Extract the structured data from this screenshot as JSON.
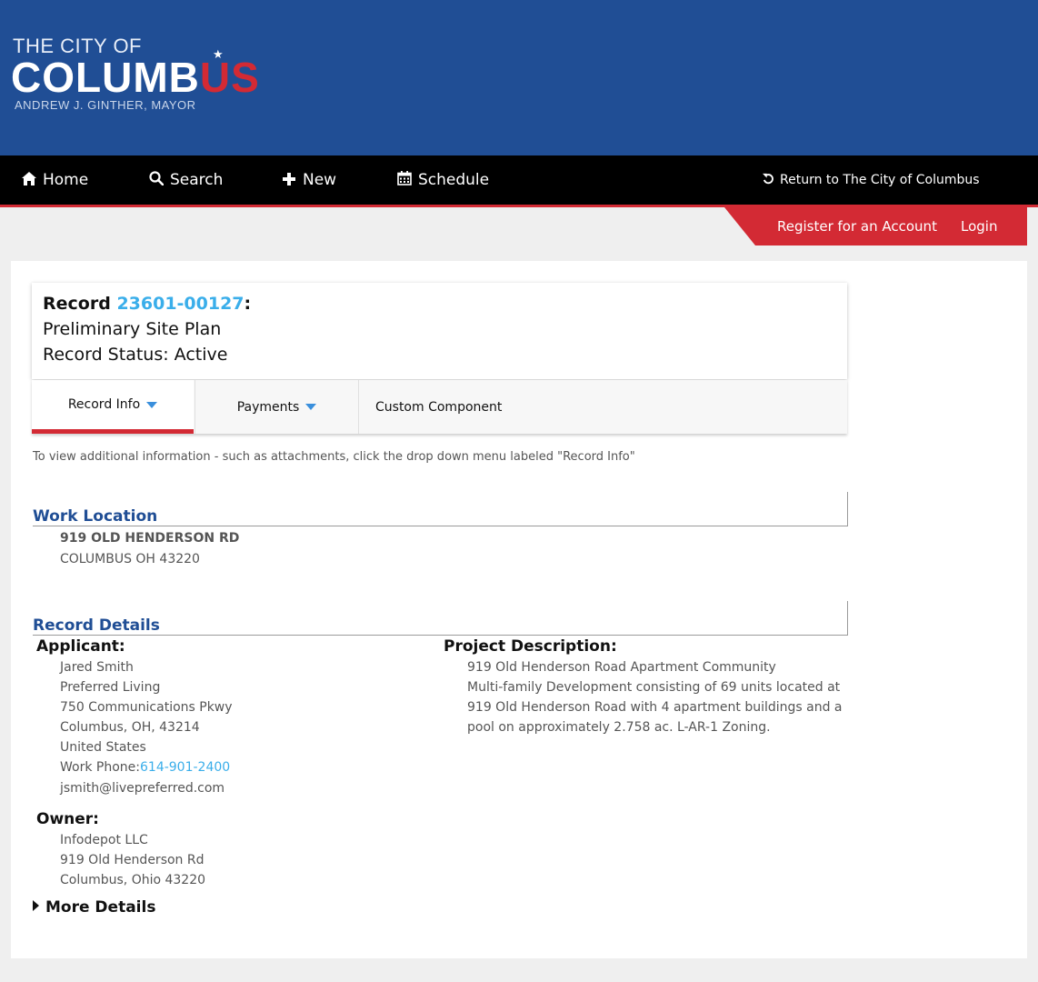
{
  "logo": {
    "line1": "THE CITY OF",
    "line2_main": "COLUMB",
    "line2_accent": "US",
    "line3": "ANDREW J. GINTHER, MAYOR"
  },
  "nav": {
    "items": [
      {
        "label": "Home",
        "icon": "home-icon"
      },
      {
        "label": "Search",
        "icon": "search-icon"
      },
      {
        "label": "New",
        "icon": "plus-icon"
      },
      {
        "label": "Schedule",
        "icon": "calendar-icon"
      }
    ],
    "return_label": "Return to The City of Columbus"
  },
  "account": {
    "register_label": "Register for an Account",
    "login_label": "Login"
  },
  "record": {
    "prefix": "Record",
    "number": "23601-00127",
    "suffix": ":",
    "type": "Preliminary Site Plan",
    "status": "Record Status: Active"
  },
  "tabs": [
    {
      "label": "Record Info"
    },
    {
      "label": "Payments"
    },
    {
      "label": "Custom Component"
    }
  ],
  "hint": "To view additional information - such as attachments, click the drop down menu labeled \"Record Info\"",
  "work_location": {
    "title": "Work Location",
    "address1": "919 OLD HENDERSON RD",
    "address2": "COLUMBUS OH 43220"
  },
  "record_details": {
    "title": "Record Details",
    "applicant": {
      "label": "Applicant:",
      "name": "Jared Smith",
      "company": "Preferred Living",
      "street": "750 Communications Pkwy",
      "city": "Columbus, OH, 43214",
      "country": "United States",
      "phone_label": "Work Phone:",
      "phone": "614-901-2400",
      "email": "jsmith@livepreferred.com"
    },
    "owner": {
      "label": "Owner:",
      "name": "Infodepot LLC",
      "street": "919 Old Henderson Rd",
      "city": "Columbus, Ohio 43220"
    },
    "project": {
      "label": "Project Description:",
      "lines": [
        "919 Old Henderson Road Apartment Community",
        "Multi-family Development consisting of 69 units located at",
        "919 Old Henderson Road with 4 apartment buildings and a",
        "pool on approximately 2.758 ac. L-AR-1 Zoning."
      ]
    },
    "more_details": "More Details"
  }
}
